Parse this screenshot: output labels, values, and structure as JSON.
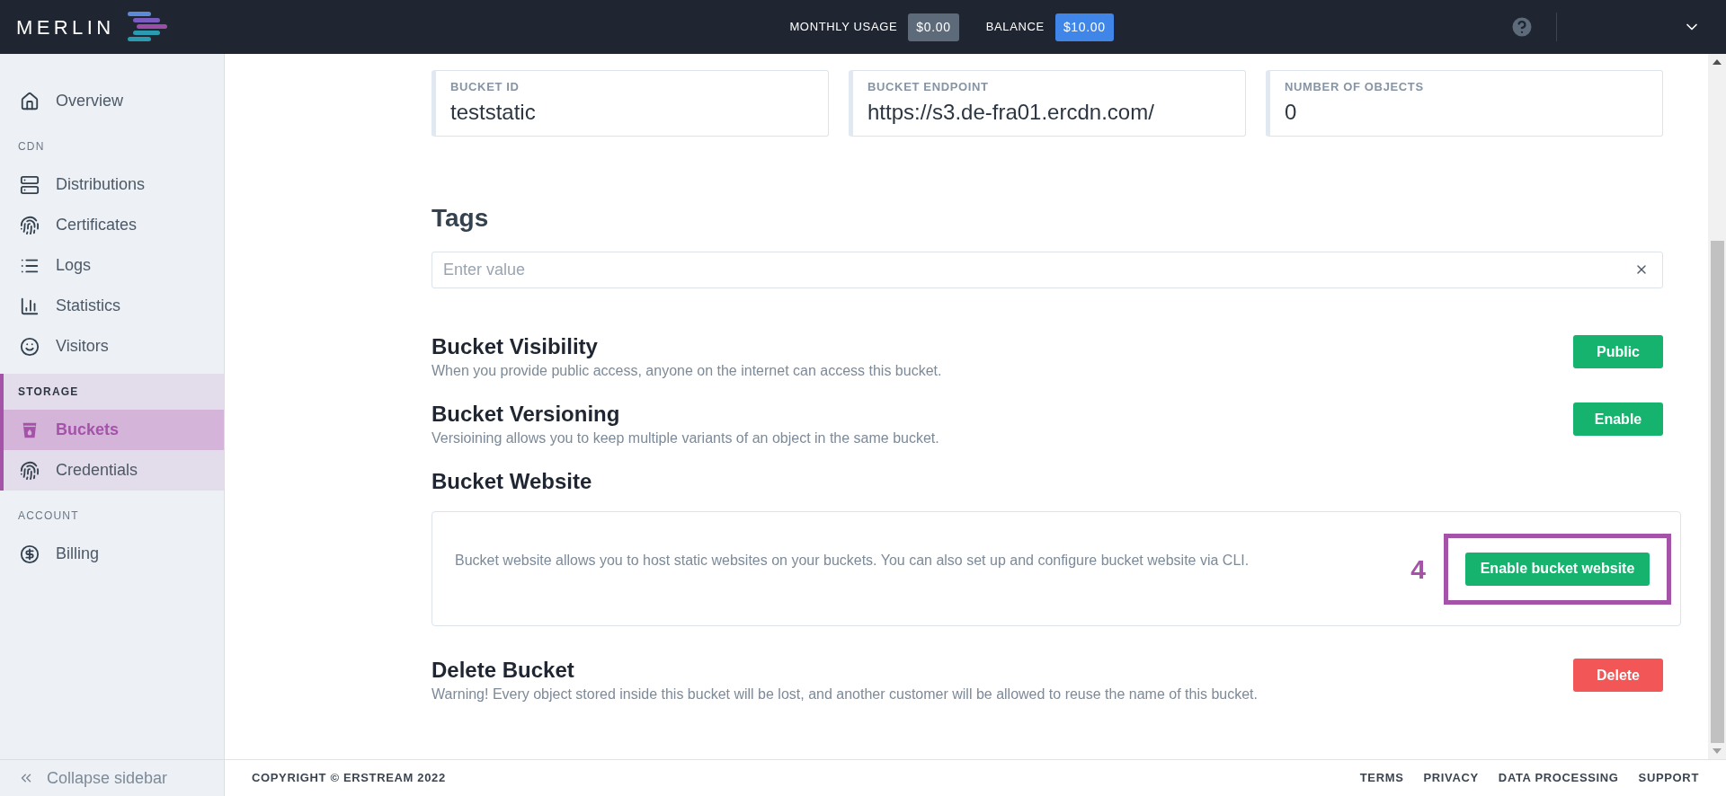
{
  "header": {
    "logo": "MERLIN",
    "monthly_usage": {
      "label": "MONTHLY USAGE",
      "value": "$0.00"
    },
    "balance": {
      "label": "BALANCE",
      "value": "$10.00"
    }
  },
  "sidebar": {
    "groups": [
      {
        "active": false,
        "items": [
          {
            "label": "Overview",
            "selected": false
          }
        ]
      },
      {
        "label": "CDN",
        "active": false,
        "items": [
          {
            "label": "Distributions",
            "selected": false
          },
          {
            "label": "Certificates",
            "selected": false
          },
          {
            "label": "Logs",
            "selected": false
          },
          {
            "label": "Statistics",
            "selected": false
          },
          {
            "label": "Visitors",
            "selected": false
          }
        ]
      },
      {
        "label": "STORAGE",
        "active": true,
        "items": [
          {
            "label": "Buckets",
            "selected": true
          },
          {
            "label": "Credentials",
            "selected": false
          }
        ]
      },
      {
        "label": "ACCOUNT",
        "active": false,
        "items": [
          {
            "label": "Billing",
            "selected": false
          }
        ]
      }
    ],
    "collapse": "Collapse sidebar"
  },
  "info_cards": [
    {
      "label": "BUCKET ID",
      "value": "teststatic"
    },
    {
      "label": "BUCKET ENDPOINT",
      "value": "https://s3.de-fra01.ercdn.com/"
    },
    {
      "label": "NUMBER OF OBJECTS",
      "value": "0"
    }
  ],
  "tags": {
    "title": "Tags",
    "placeholder": "Enter value"
  },
  "settings": [
    {
      "kind": "row",
      "title": "Bucket Visibility",
      "description": "When you provide public access, anyone on the internet can access this bucket.",
      "button": {
        "label": "Public",
        "color": "#16b36e"
      }
    },
    {
      "kind": "row",
      "title": "Bucket Versioning",
      "description": "Versioining allows you to keep multiple variants of an object in the same bucket.",
      "button": {
        "label": "Enable",
        "color": "#16b36e"
      }
    },
    {
      "kind": "panel",
      "title": "Bucket Website",
      "description": "Bucket website allows you to host static websites on your buckets. You can also set up and configure bucket website via CLI.",
      "button": {
        "label": "Enable bucket website",
        "color": "#16b36e"
      },
      "annotation": "4"
    },
    {
      "kind": "row",
      "title": "Delete Bucket",
      "description": "Warning! Every object stored inside this bucket will be lost, and another customer will be allowed to reuse the name of this bucket.",
      "button": {
        "label": "Delete",
        "color": "#f25656"
      }
    }
  ],
  "footer": {
    "copyright": "COPYRIGHT © ERSTREAM 2022",
    "links": [
      "TERMS",
      "PRIVACY",
      "DATA PROCESSING",
      "SUPPORT"
    ]
  }
}
